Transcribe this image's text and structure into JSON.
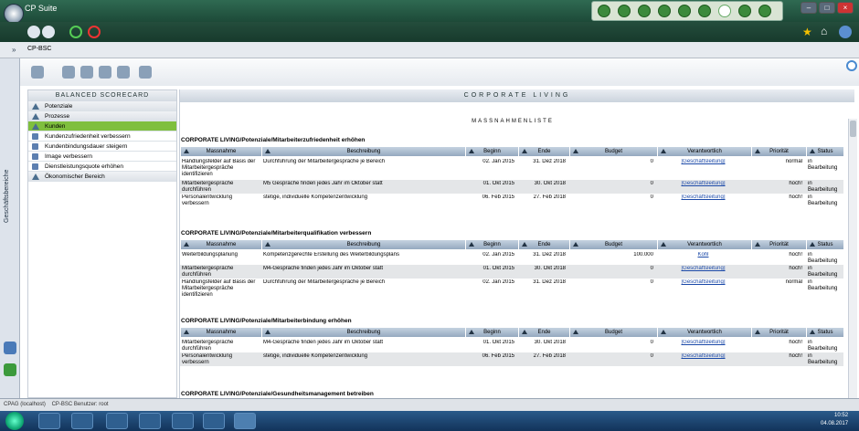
{
  "window": {
    "title": "CP Suite",
    "tab": "CP-BSC"
  },
  "leftpanel": {
    "label": "Geschäftsbereiche"
  },
  "bsc": {
    "title": "BALANCED SCORECARD",
    "items": [
      {
        "label": "Potenziale",
        "type": "cat"
      },
      {
        "label": "Prozesse",
        "type": "cat"
      },
      {
        "label": "Kunden",
        "type": "active"
      },
      {
        "label": "Kundenzufriedenheit verbessern",
        "type": "sub"
      },
      {
        "label": "Kundenbindungsdauer steigern",
        "type": "sub"
      },
      {
        "label": "Image verbessern",
        "type": "sub"
      },
      {
        "label": "Dienstleistungsquote erhöhen",
        "type": "sub"
      },
      {
        "label": "Ökonomischer Bereich",
        "type": "cat"
      }
    ]
  },
  "content": {
    "band": "CORPORATE LIVING",
    "subtitle": "MASSNAHMENLISTE",
    "headers": {
      "m": "Massnahme",
      "b": "Beschreibung",
      "beg": "Beginn",
      "end": "Ende",
      "bud": "Budget",
      "v": "Verantwortlich",
      "p": "Priorität",
      "s": "Status"
    },
    "sections": [
      {
        "title": "CORPORATE LIVING/Potenziale/Mitarbeiterzufriedenheit erhöhen",
        "rows": [
          {
            "m": "Handlungsfelder auf Basis der Mitarbeitergespräche identifizieren",
            "b": "Durchführung der Mitarbeitergespräche je Bereich",
            "beg": "02. Jan 2015",
            "end": "31. Dez 2018",
            "bud": "0",
            "v": "[Geschäftsleitung]",
            "p": "normal",
            "s": "in Bearbeitung"
          },
          {
            "m": "Mitarbeitergespräche durchführen",
            "b": "M5 Gespräche finden jedes Jahr im Oktober statt",
            "beg": "01. Okt 2015",
            "end": "30. Okt 2018",
            "bud": "0",
            "v": "[Geschäftsleitung]",
            "p": "hoch!",
            "s": "in Bearbeitung"
          },
          {
            "m": "Personalentwicklung verbessern",
            "b": "stetige, individuelle Kompetenzentwicklung",
            "beg": "06. Feb 2015",
            "end": "27. Feb 2018",
            "bud": "0",
            "v": "[Geschäftsleitung]",
            "p": "hoch!",
            "s": "in Bearbeitung"
          }
        ]
      },
      {
        "title": "CORPORATE LIVING/Potenziale/Mitarbeiterqualifikation verbessern",
        "rows": [
          {
            "m": "Weiterbildungsplanung",
            "b": "Kompetenzgerechte Erstellung des Weiterbildungsplans",
            "beg": "02. Jan 2015",
            "end": "31. Dez 2018",
            "bud": "100.000",
            "v": "Kohl",
            "p": "hoch!",
            "s": "in Bearbeitung"
          },
          {
            "m": "Mitarbeitergespräche durchführen",
            "b": "M4-Gespräche finden jedes Jahr im Oktober statt",
            "beg": "01. Okt 2015",
            "end": "30. Okt 2018",
            "bud": "0",
            "v": "[Geschäftsleitung]",
            "p": "hoch!",
            "s": "in Bearbeitung"
          },
          {
            "m": "Handlungsfelder auf Basis der Mitarbeitergespräche identifizieren",
            "b": "Durchführung der Mitarbeitergespräche je Bereich",
            "beg": "02. Jan 2015",
            "end": "31. Dez 2018",
            "bud": "0",
            "v": "[Geschäftsleitung]",
            "p": "normal",
            "s": "in Bearbeitung"
          }
        ]
      },
      {
        "title": "CORPORATE LIVING/Potenziale/Mitarbeiterbindung erhöhen",
        "rows": [
          {
            "m": "Mitarbeitergespräche durchführen",
            "b": "M4-Gespräche finden jedes Jahr im Oktober statt",
            "beg": "01. Okt 2015",
            "end": "30. Okt 2018",
            "bud": "0",
            "v": "[Geschäftsleitung]",
            "p": "hoch!",
            "s": "in Bearbeitung"
          },
          {
            "m": "Personalentwicklung verbessern",
            "b": "stetige, individuelle Kompetenzentwicklung",
            "beg": "06. Feb 2015",
            "end": "27. Feb 2018",
            "bud": "0",
            "v": "[Geschäftsleitung]",
            "p": "hoch!",
            "s": "in Bearbeitung"
          }
        ]
      },
      {
        "title": "CORPORATE LIVING/Potenziale/Gesundheitsmanagement betreiben",
        "rows": []
      }
    ]
  },
  "statusbar": {
    "a": "CPAG (localhost)",
    "b": "CP-BSC Benutzer: root"
  },
  "clock": {
    "time": "10:52",
    "date": "04.08.2017"
  }
}
